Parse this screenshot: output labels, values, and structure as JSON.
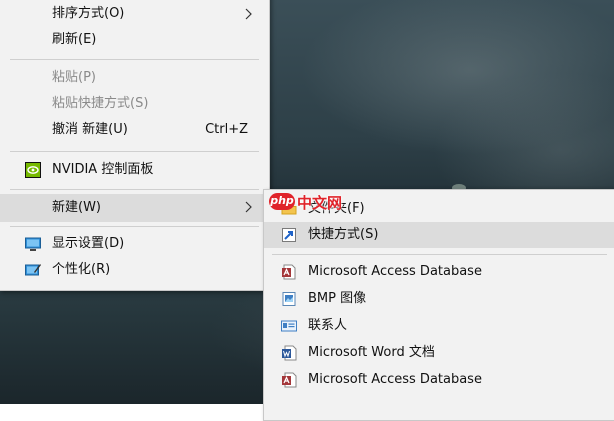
{
  "context_menu": {
    "items": [
      {
        "label": "排序方式(O)"
      },
      {
        "label": "刷新(E)"
      },
      {
        "label": "粘贴(P)"
      },
      {
        "label": "粘贴快捷方式(S)"
      },
      {
        "label": "撤消 新建(U)",
        "shortcut": "Ctrl+Z"
      },
      {
        "label": "NVIDIA 控制面板"
      },
      {
        "label": "新建(W)"
      },
      {
        "label": "显示设置(D)"
      },
      {
        "label": "个性化(R)"
      }
    ]
  },
  "new_submenu": {
    "items": [
      {
        "label": "文件夹(F)"
      },
      {
        "label": "快捷方式(S)"
      },
      {
        "label": "Microsoft Access Database"
      },
      {
        "label": "BMP 图像"
      },
      {
        "label": "联系人"
      },
      {
        "label": "Microsoft Word 文档"
      },
      {
        "label": "Microsoft Access Database"
      }
    ]
  },
  "watermark": {
    "badge": "php",
    "text": "中文网"
  },
  "colors": {
    "menu_bg": "#f2f2f2",
    "hover_bg": "#dcdcdc",
    "disabled_text": "#8a8a8a",
    "nvidia_green": "#76b900"
  }
}
